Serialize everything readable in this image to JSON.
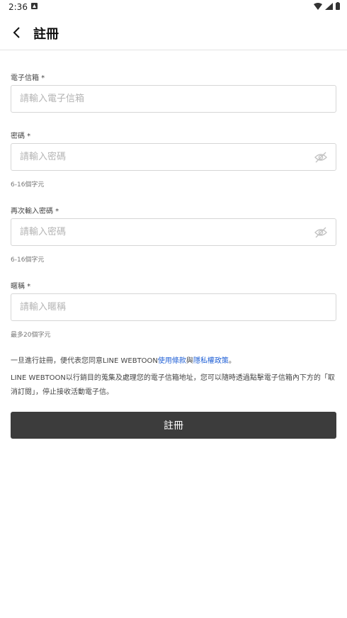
{
  "status": {
    "time": "2:36"
  },
  "header": {
    "title": "註冊"
  },
  "form": {
    "email": {
      "label": "電子信箱 *",
      "placeholder": "請輸入電子信箱"
    },
    "password": {
      "label": "密碼 *",
      "placeholder": "請輸入密碼",
      "hint": "6-16個字元"
    },
    "password_confirm": {
      "label": "再次輸入密碼 *",
      "placeholder": "請輸入密碼",
      "hint": "6-16個字元"
    },
    "nickname": {
      "label": "暱稱 *",
      "placeholder": "請輸入暱稱",
      "hint": "最多20個字元"
    }
  },
  "consent": {
    "prefix": "一旦進行註冊，便代表您同意LINE WEBTOON",
    "terms_link": "使用條款",
    "middle": "與",
    "privacy_link": "隱私權政策",
    "suffix": "。"
  },
  "notice": "LINE WEBTOON以行銷目的蒐集及處理您的電子信箱地址，您可以隨時透過點擊電子信箱內下方的「取消訂閱」，停止接收活動電子信。",
  "submit_label": "註冊",
  "colors": {
    "link": "#2060d6",
    "button": "#3c3c3c"
  }
}
